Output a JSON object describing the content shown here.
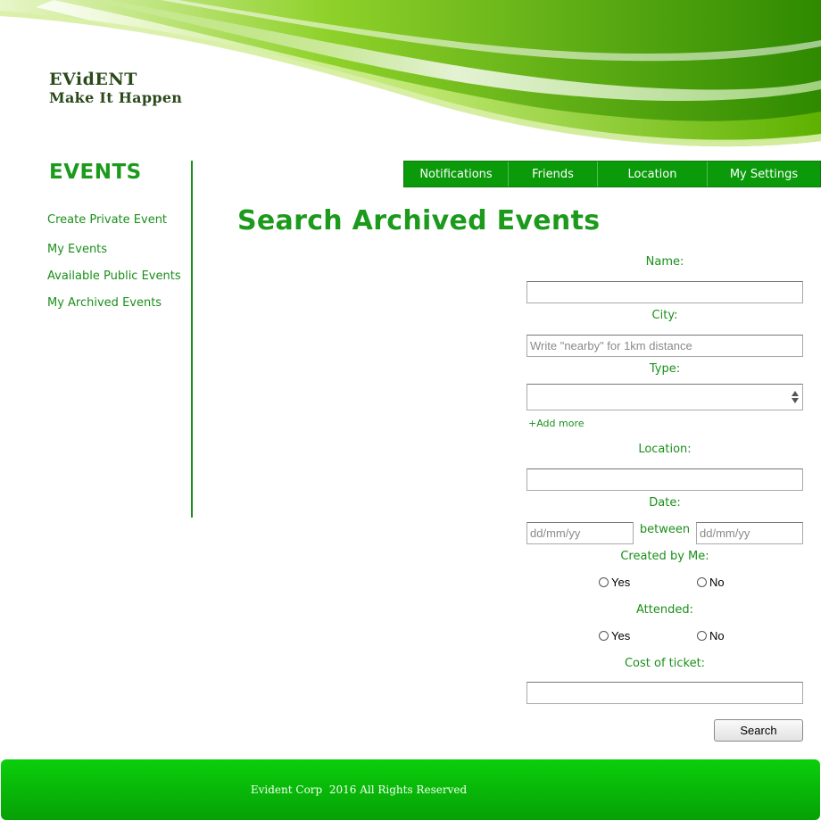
{
  "brand": {
    "name": "EVidENT",
    "tagline": "Make It Happen"
  },
  "sidebar": {
    "title": "EVENTS",
    "items": [
      {
        "label": "Create Private Event"
      },
      {
        "label": "My Events"
      },
      {
        "label": "Available Public Events"
      },
      {
        "label": "My Archived Events"
      }
    ]
  },
  "nav": {
    "items": [
      {
        "label": "Notifications"
      },
      {
        "label": "Friends"
      },
      {
        "label": "Location"
      },
      {
        "label": "My Settings"
      }
    ]
  },
  "page": {
    "title": "Search Archived Events"
  },
  "form": {
    "name_label": "Name:",
    "name_value": "",
    "city_label": "City:",
    "city_placeholder": "Write \"nearby\" for 1km distance",
    "type_label": "Type:",
    "add_more": "+Add more",
    "location_label": "Location:",
    "location_value": "",
    "date_label": "Date:",
    "date_from_placeholder": "dd/mm/yy",
    "between": "between",
    "date_to_placeholder": "dd/mm/yy",
    "created_by_me_label": "Created by Me:",
    "attended_label": "Attended:",
    "yes": "Yes",
    "no": "No",
    "cost_label": "Cost of ticket:",
    "cost_value": "",
    "search_button": "Search"
  },
  "footer": {
    "text": "Evident Corp  2016 All Rights Reserved"
  },
  "colors": {
    "accent": "#1a8f1a",
    "nav_bg": "#0a9a0a",
    "footer_bg": "#06b006"
  }
}
